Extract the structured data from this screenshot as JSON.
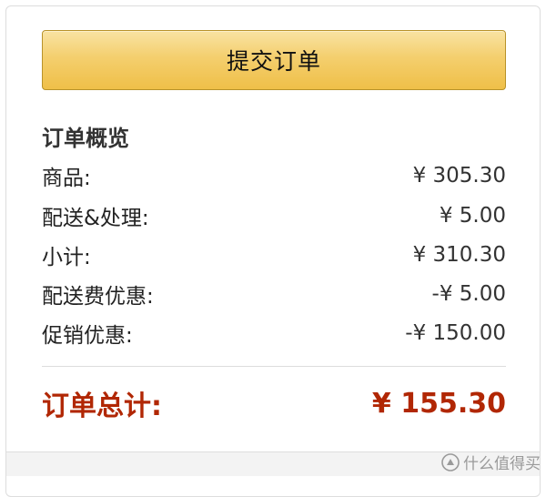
{
  "actions": {
    "submit_label": "提交订单"
  },
  "summary": {
    "title": "订单概览",
    "rows": [
      {
        "label": "商品:",
        "amount": "¥ 305.30"
      },
      {
        "label": "配送&处理:",
        "amount": "¥ 5.00"
      },
      {
        "label": "小计:",
        "amount": "¥ 310.30"
      },
      {
        "label": "配送费优惠:",
        "amount": "-¥ 5.00"
      },
      {
        "label": "促销优惠:",
        "amount": "-¥ 150.00"
      }
    ],
    "total": {
      "label": "订单总计:",
      "amount": "¥ 155.30"
    }
  },
  "watermark": {
    "text": "什么值得买",
    "icon": "smzdm-logo-icon"
  },
  "colors": {
    "button": "#f0c14b",
    "total": "#b12704",
    "border": "#dddddd"
  }
}
